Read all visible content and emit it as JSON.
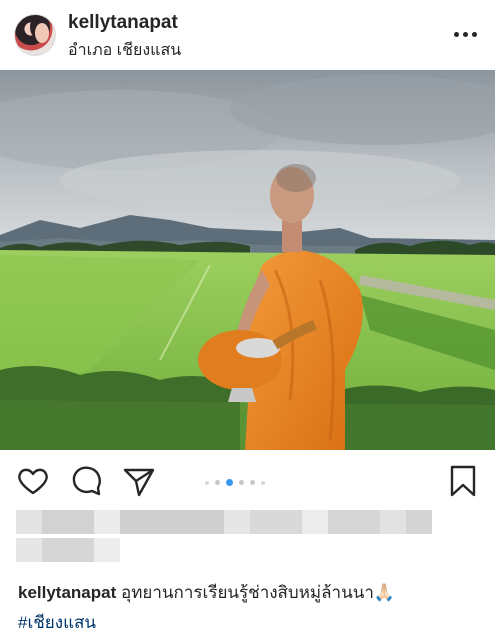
{
  "post": {
    "username": "kellytanapat",
    "location": "อำเภอ เชียงแสน",
    "caption_user": "kellytanapat",
    "caption_text": "อุทยานการเรียนรู้ช่างสิบหมู่ล้านนา🙏🏻",
    "hashtag": "#เชียงแสน"
  },
  "icons": {
    "more": "more-options-icon",
    "like": "heart-icon",
    "comment": "comment-icon",
    "share": "paper-plane-icon",
    "save": "bookmark-icon"
  },
  "carousel": {
    "slide_count": 6,
    "active_index": 2
  },
  "colors": {
    "text": "#262626",
    "hashtag": "#003569",
    "active_dot": "#3897f0"
  }
}
